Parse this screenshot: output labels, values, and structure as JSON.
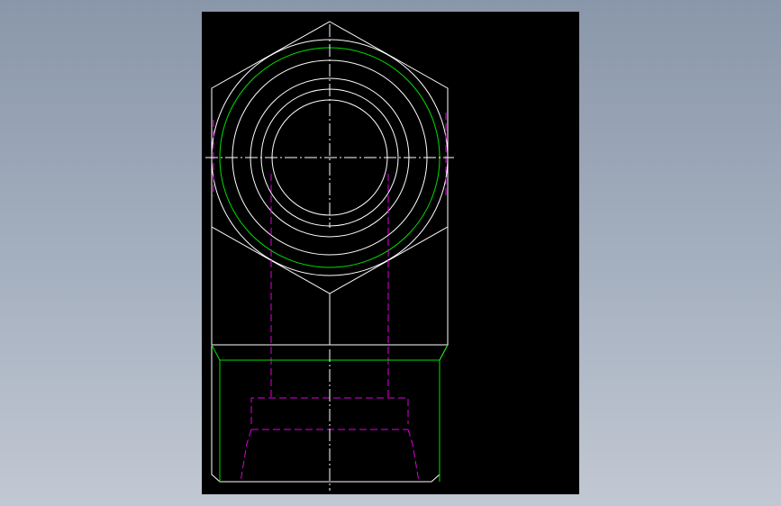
{
  "viewport": {
    "background": "#000000"
  },
  "colors": {
    "outline": "#ffffff",
    "thread": "#00e000",
    "hidden": "#e000e0",
    "page_background_top": "#8a97aa",
    "page_background_bottom": "#c2c8d3"
  },
  "drawing": {
    "subject": "hex-nut-two-view",
    "views": [
      "top-view",
      "front-view"
    ]
  }
}
